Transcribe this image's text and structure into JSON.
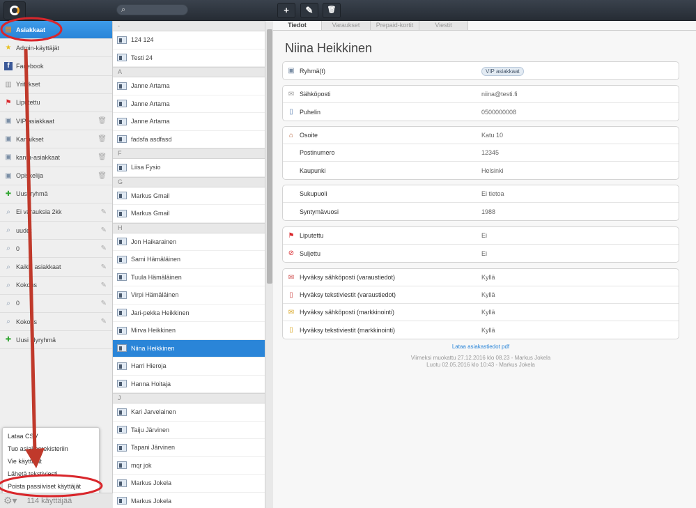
{
  "toolbar": {
    "search_placeholder": "",
    "add": "+",
    "edit": "✎",
    "delete": "🗑"
  },
  "sidebar": {
    "items": [
      {
        "label": "Asiakkaat",
        "icon": "address-book-icon",
        "active": true
      },
      {
        "label": "Admin-käyttäjät",
        "icon": "star-icon"
      },
      {
        "label": "Facebook",
        "icon": "facebook-icon"
      },
      {
        "label": "Yritykset",
        "icon": "building-icon"
      },
      {
        "label": "Liputettu",
        "icon": "flag-icon"
      },
      {
        "label": "VIP asiakkaat",
        "icon": "group-icon",
        "action": "trash"
      },
      {
        "label": "Kanaikset",
        "icon": "group-icon",
        "action": "trash"
      },
      {
        "label": "kanta-asiakkaat",
        "icon": "group-icon",
        "action": "trash"
      },
      {
        "label": "Opiskelija",
        "icon": "group-icon",
        "action": "trash"
      },
      {
        "label": "Uusi ryhmä",
        "icon": "plus-icon"
      },
      {
        "label": "Ei varauksia 2kk",
        "icon": "search-icon",
        "action": "edit"
      },
      {
        "label": "uudet",
        "icon": "search-icon",
        "action": "edit"
      },
      {
        "label": "0",
        "icon": "search-icon",
        "action": "edit"
      },
      {
        "label": "Kaikki asiakkaat",
        "icon": "search-icon",
        "action": "edit"
      },
      {
        "label": "Kokous",
        "icon": "search-icon",
        "action": "edit"
      },
      {
        "label": "0",
        "icon": "search-icon",
        "action": "edit"
      },
      {
        "label": "Kokous",
        "icon": "search-icon",
        "action": "edit"
      },
      {
        "label": "Uusi älyryhmä",
        "icon": "plus-icon"
      }
    ]
  },
  "menu": {
    "items": [
      "Lataa CSV",
      "Tuo asiakasrekisteriin",
      "Vie käyttäjät",
      "Lähetä tekstiviesti",
      "Poista passiiviset käyttäjät"
    ]
  },
  "footer": {
    "count": "114 käyttäjää"
  },
  "list": [
    {
      "header": "-"
    },
    {
      "name": "124 124"
    },
    {
      "name": "Testi 24"
    },
    {
      "header": "A"
    },
    {
      "name": "Janne Artama"
    },
    {
      "name": "Janne Artama"
    },
    {
      "name": "Janne Artama"
    },
    {
      "name": "fadsfa asdfasd"
    },
    {
      "header": "F"
    },
    {
      "name": "Liisa Fysio"
    },
    {
      "header": "G"
    },
    {
      "name": "Markus Gmail"
    },
    {
      "name": "Markus Gmail"
    },
    {
      "header": "H"
    },
    {
      "name": "Jon Haikarainen"
    },
    {
      "name": "Sami Hämäläinen"
    },
    {
      "name": "Tuula Hämäläinen"
    },
    {
      "name": "Virpi Hämäläinen"
    },
    {
      "name": "Jari-pekka Heikkinen"
    },
    {
      "name": "Mirva Heikkinen"
    },
    {
      "name": "Niina Heikkinen",
      "selected": true
    },
    {
      "name": "Harri Hieroja"
    },
    {
      "name": "Hanna Hoitaja"
    },
    {
      "header": "J"
    },
    {
      "name": "Kari Jarvelainen"
    },
    {
      "name": "Taiju Järvinen"
    },
    {
      "name": "Tapani Järvinen"
    },
    {
      "name": "mqr jok"
    },
    {
      "name": "Markus Jokela"
    },
    {
      "name": "Markus Jokela"
    }
  ],
  "details": {
    "tabs": [
      "Tiedot",
      "Varaukset",
      "Prepaid-kortit",
      "Viestit"
    ],
    "name": "Niina Heikkinen",
    "cards": [
      [
        {
          "label": "Ryhmä(t)",
          "value": "VIP asiakkaat",
          "type": "badge",
          "icon": "group-icon"
        }
      ],
      [
        {
          "label": "Sähköposti",
          "value": "niina@testi.fi",
          "type": "link",
          "icon": "envelope-icon"
        },
        {
          "label": "Puhelin",
          "value": "0500000008",
          "type": "link",
          "icon": "phone-icon"
        }
      ],
      [
        {
          "label": "Osoite",
          "value": "Katu 10",
          "icon": "house-icon"
        },
        {
          "label": "Postinumero",
          "value": "12345"
        },
        {
          "label": "Kaupunki",
          "value": "Helsinki"
        }
      ],
      [
        {
          "label": "Sukupuoli",
          "value": "Ei tietoa"
        },
        {
          "label": "Syntymävuosi",
          "value": "1988"
        }
      ],
      [
        {
          "label": "Liputettu",
          "value": "Ei",
          "icon": "flag-icon"
        },
        {
          "label": "Suljettu",
          "value": "Ei",
          "icon": "blocked-icon"
        }
      ],
      [
        {
          "label": "Hyväksy sähköposti (varaustiedot)",
          "value": "Kyllä",
          "icon": "email-calendar-icon"
        },
        {
          "label": "Hyväksy tekstiviestit (varaustiedot)",
          "value": "Kyllä",
          "icon": "sms-calendar-icon"
        },
        {
          "label": "Hyväksy sähköposti (markkinointi)",
          "value": "Kyllä",
          "icon": "email-marketing-icon"
        },
        {
          "label": "Hyväksy tekstiviestit (markkinointi)",
          "value": "Kyllä",
          "icon": "sms-marketing-icon"
        }
      ]
    ],
    "pdf_link": "Lataa asiakastiedot pdf",
    "modified": "Viimeksi muokattu 27.12.2016 klo 08.23 - Markus Jokela",
    "created": "Luotu 02.05.2016 klo 10:43 - Markus Jokela"
  },
  "colors": {
    "accent": "#2a85d8",
    "annotation": "#d9262b",
    "topbar": "#2e353e"
  }
}
